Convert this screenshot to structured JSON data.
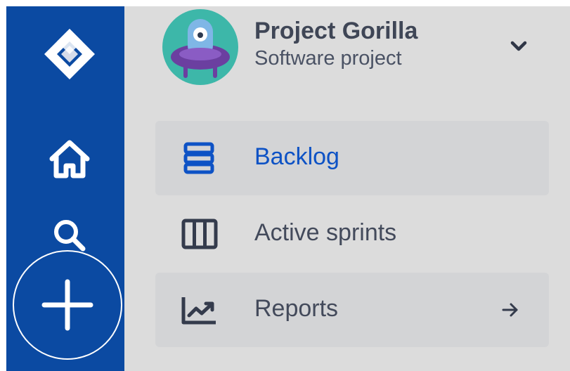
{
  "project": {
    "name": "Project Gorilla",
    "type": "Software project"
  },
  "nav": {
    "items": [
      {
        "label": "Backlog",
        "icon": "backlog-icon",
        "selected": true
      },
      {
        "label": "Active sprints",
        "icon": "board-columns-icon",
        "selected": false
      },
      {
        "label": "Reports",
        "icon": "chart-trend-icon",
        "selected": false
      }
    ]
  },
  "rail": {
    "icons": [
      "jira-logo-icon",
      "home-icon",
      "search-icon",
      "plus-icon"
    ]
  },
  "colors": {
    "rail": "#0b4aa2",
    "sidebar": "#dcdcdc",
    "selected_text": "#0d52c5",
    "text": "#434a5b",
    "avatar": "#3db7a9"
  }
}
